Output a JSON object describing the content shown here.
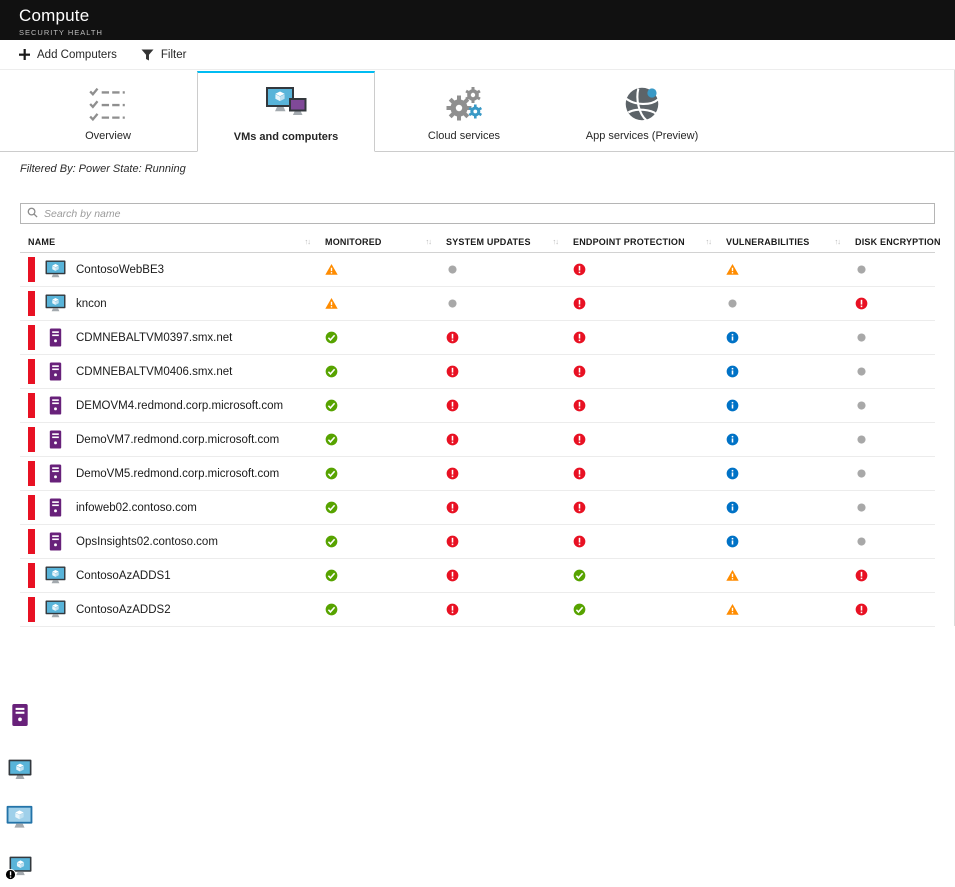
{
  "header": {
    "title": "Compute",
    "subtitle": "SECURITY HEALTH"
  },
  "toolbar": {
    "add_label": "Add Computers",
    "filter_label": "Filter"
  },
  "tabs": [
    {
      "label": "Overview",
      "icon": "checklist-icon",
      "selected": false
    },
    {
      "label": "VMs and computers",
      "icon": "vm-monitors-icon",
      "selected": true
    },
    {
      "label": "Cloud services",
      "icon": "gears-icon",
      "selected": false
    },
    {
      "label": "App services (Preview)",
      "icon": "globe-icon",
      "selected": false
    }
  ],
  "filter_note": "Filtered By: Power State: Running",
  "search": {
    "placeholder": "Search by name"
  },
  "table": {
    "sort_glyph": "↑↓",
    "columns": [
      "NAME",
      "MONITORED",
      "SYSTEM UPDATES",
      "ENDPOINT PROTECTION",
      "VULNERABILITIES",
      "DISK ENCRYPTION"
    ],
    "rows": [
      {
        "name": "ContosoWebBE3",
        "icon": "vm",
        "severity": "red",
        "statuses": [
          "warning",
          "none",
          "error",
          "warning",
          "none"
        ]
      },
      {
        "name": "kncon",
        "icon": "vm",
        "severity": "red",
        "statuses": [
          "warning",
          "none",
          "error",
          "none",
          "error"
        ]
      },
      {
        "name": "CDMNEBALTVM0397.smx.net",
        "icon": "server",
        "severity": "red",
        "statuses": [
          "ok",
          "error",
          "error",
          "info",
          "none"
        ]
      },
      {
        "name": "CDMNEBALTVM0406.smx.net",
        "icon": "server",
        "severity": "red",
        "statuses": [
          "ok",
          "error",
          "error",
          "info",
          "none"
        ]
      },
      {
        "name": "DEMOVM4.redmond.corp.microsoft.com",
        "icon": "server",
        "severity": "red",
        "statuses": [
          "ok",
          "error",
          "error",
          "info",
          "none"
        ]
      },
      {
        "name": "DemoVM7.redmond.corp.microsoft.com",
        "icon": "server",
        "severity": "red",
        "statuses": [
          "ok",
          "error",
          "error",
          "info",
          "none"
        ]
      },
      {
        "name": "DemoVM5.redmond.corp.microsoft.com",
        "icon": "server",
        "severity": "red",
        "statuses": [
          "ok",
          "error",
          "error",
          "info",
          "none"
        ]
      },
      {
        "name": "infoweb02.contoso.com",
        "icon": "server",
        "severity": "red",
        "statuses": [
          "ok",
          "error",
          "error",
          "info",
          "none"
        ]
      },
      {
        "name": "OpsInsights02.contoso.com",
        "icon": "server",
        "severity": "red",
        "statuses": [
          "ok",
          "error",
          "error",
          "info",
          "none"
        ]
      },
      {
        "name": "ContosoAzADDS1",
        "icon": "vm",
        "severity": "red",
        "statuses": [
          "ok",
          "error",
          "ok",
          "warning",
          "error"
        ]
      },
      {
        "name": "ContosoAzADDS2",
        "icon": "vm",
        "severity": "red",
        "statuses": [
          "ok",
          "error",
          "ok",
          "warning",
          "error"
        ]
      }
    ]
  },
  "colors": {
    "tab_accent": "#00BCF2",
    "severity_red": "#E81123",
    "server_purple": "#68217A",
    "vm_screen_blue": "#59B4D9"
  },
  "status_colors": {
    "ok": "#57A300",
    "warning": "#FF8C00",
    "error": "#E81123",
    "info": "#0072C6",
    "none": "#A8A8A8"
  },
  "footer_icons": [
    "server-icon",
    "vm-monitor-icon",
    "vm-monitor-cube-icon",
    "vm-monitor-alert-icon"
  ]
}
